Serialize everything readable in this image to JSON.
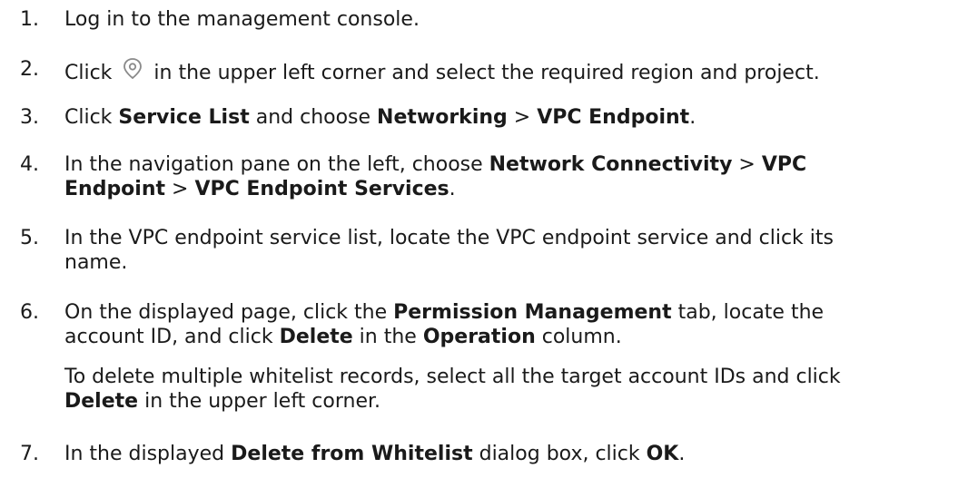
{
  "steps": [
    {
      "num": "1.",
      "text": "Log in to the management console."
    },
    {
      "num": "2.",
      "pre": "Click",
      "icon": "location-pin-icon",
      "post": "in the upper left corner and select the required region and project."
    },
    {
      "num": "3.",
      "t1": "Click ",
      "b1": "Service List",
      "t2": " and choose ",
      "b2": "Networking",
      "t3": " > ",
      "b3": "VPC Endpoint",
      "t4": "."
    },
    {
      "num": "4.",
      "t1": "In the navigation pane on the left, choose ",
      "b1": "Network Connectivity",
      "t2": " > ",
      "b2": "VPC",
      "b3": "Endpoint",
      "t3": " > ",
      "b4": "VPC Endpoint Services",
      "t4": "."
    },
    {
      "num": "5.",
      "line1": "In the VPC endpoint service list, locate the VPC endpoint service and click its",
      "line2": "name."
    },
    {
      "num": "6.",
      "t1": "On the displayed page, click the ",
      "b1": "Permission Management",
      "t2": " tab, locate the",
      "t3": "account ID, and click ",
      "b2": "Delete",
      "t4": " in the ",
      "b3": "Operation",
      "t5": " column.",
      "p2_t1": "To delete multiple whitelist records, select all the target account IDs and click",
      "p2_b1": "Delete",
      "p2_t2": " in the upper left corner."
    },
    {
      "num": "7.",
      "t1": "In the displayed ",
      "b1": "Delete from Whitelist",
      "t2": " dialog box, click ",
      "b2": "OK",
      "t3": "."
    }
  ],
  "icon_color": "#8a8a8a"
}
